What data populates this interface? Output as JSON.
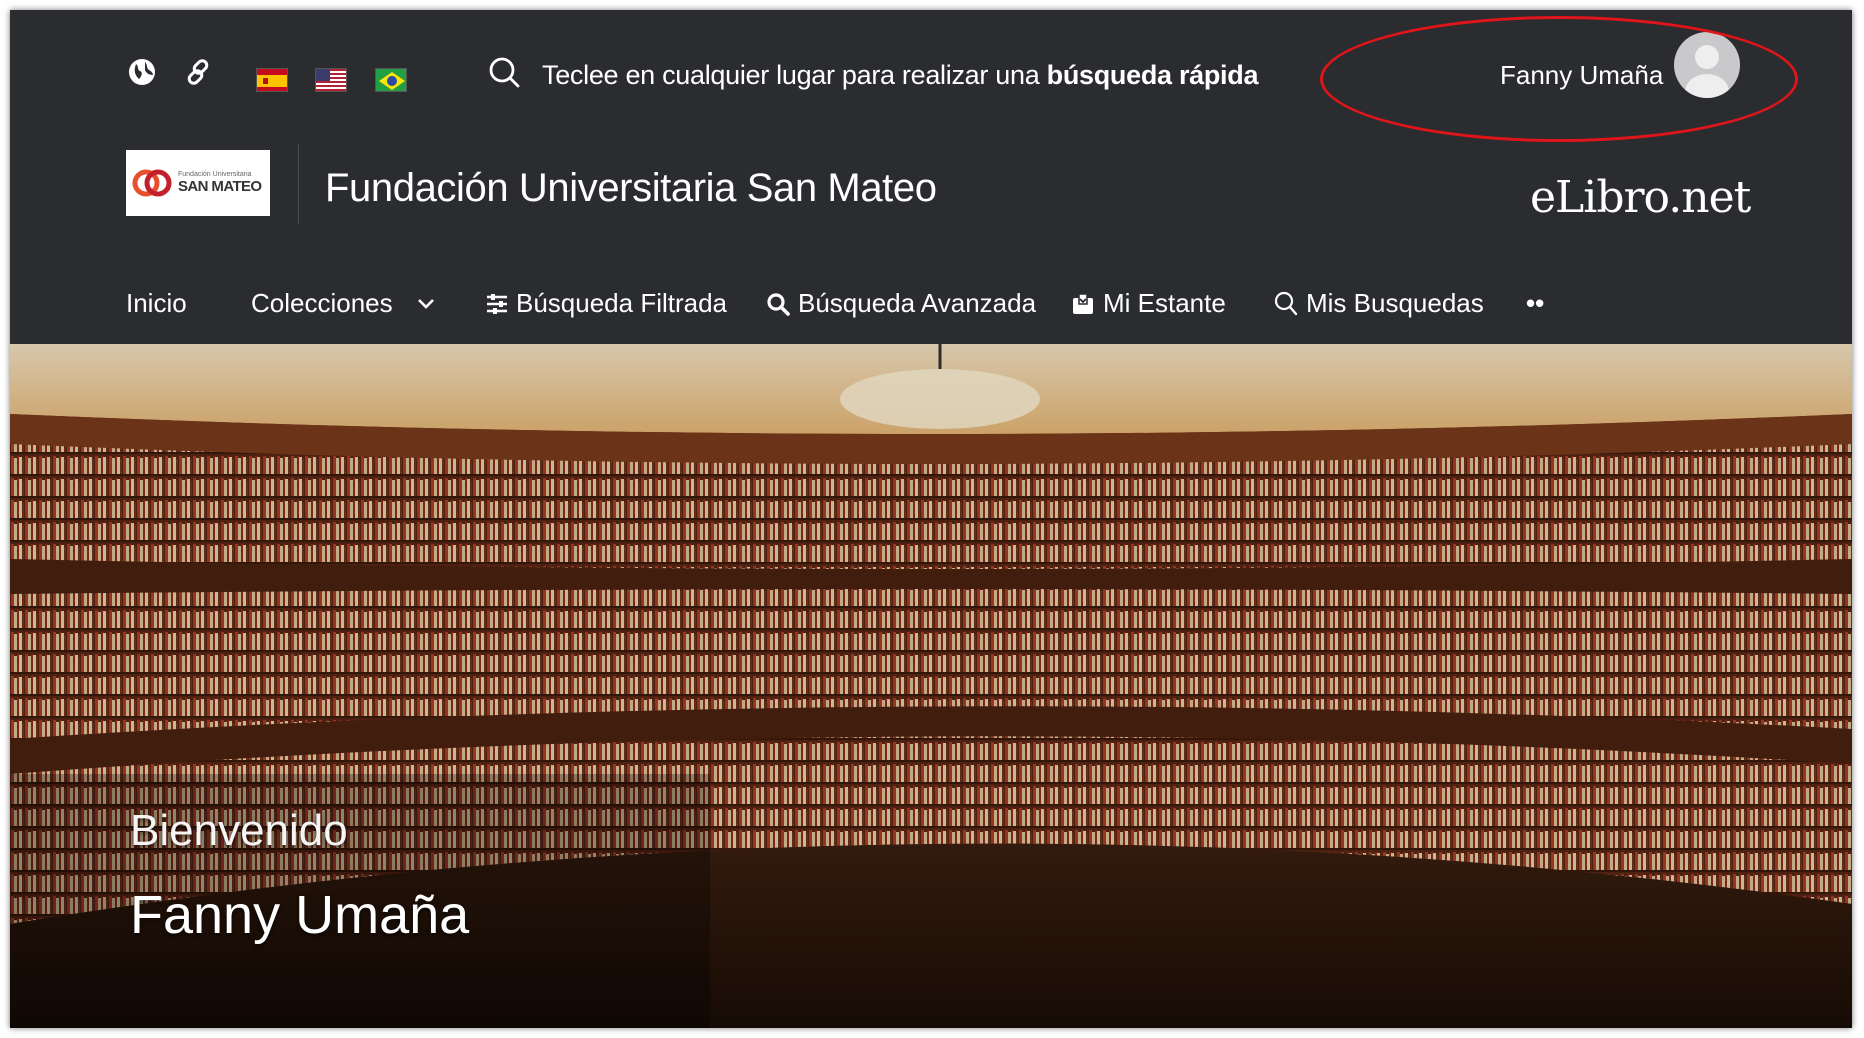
{
  "topbar": {
    "icons": [
      "globe-icon",
      "link-icon"
    ],
    "flags": [
      "flag-es",
      "flag-us",
      "flag-br"
    ],
    "search_hint_prefix": "Teclee en cualquier lugar para realizar una ",
    "search_hint_bold": "búsqueda rápida",
    "user_name": "Fanny Umaña",
    "highlight_color": "#e0151a"
  },
  "brand": {
    "logo_small": "Fundación Universitaria",
    "logo_main": "SAN MATEO",
    "institution": "Fundación Universitaria San Mateo",
    "product": "eLibro.net"
  },
  "nav": {
    "inicio": "Inicio",
    "colecciones": "Colecciones",
    "busqueda_filtrada": "Búsqueda Filtrada",
    "busqueda_avanzada": "Búsqueda Avanzada",
    "mi_estante": "Mi Estante",
    "mis_busquedas": "Mis Busquedas",
    "more": "••"
  },
  "hero": {
    "welcome": "Bienvenido",
    "user_name": "Fanny Umaña"
  },
  "colors": {
    "header_bg": "#2b2c30",
    "text": "#ffffff",
    "hero_warm": "#8a4a1f"
  }
}
